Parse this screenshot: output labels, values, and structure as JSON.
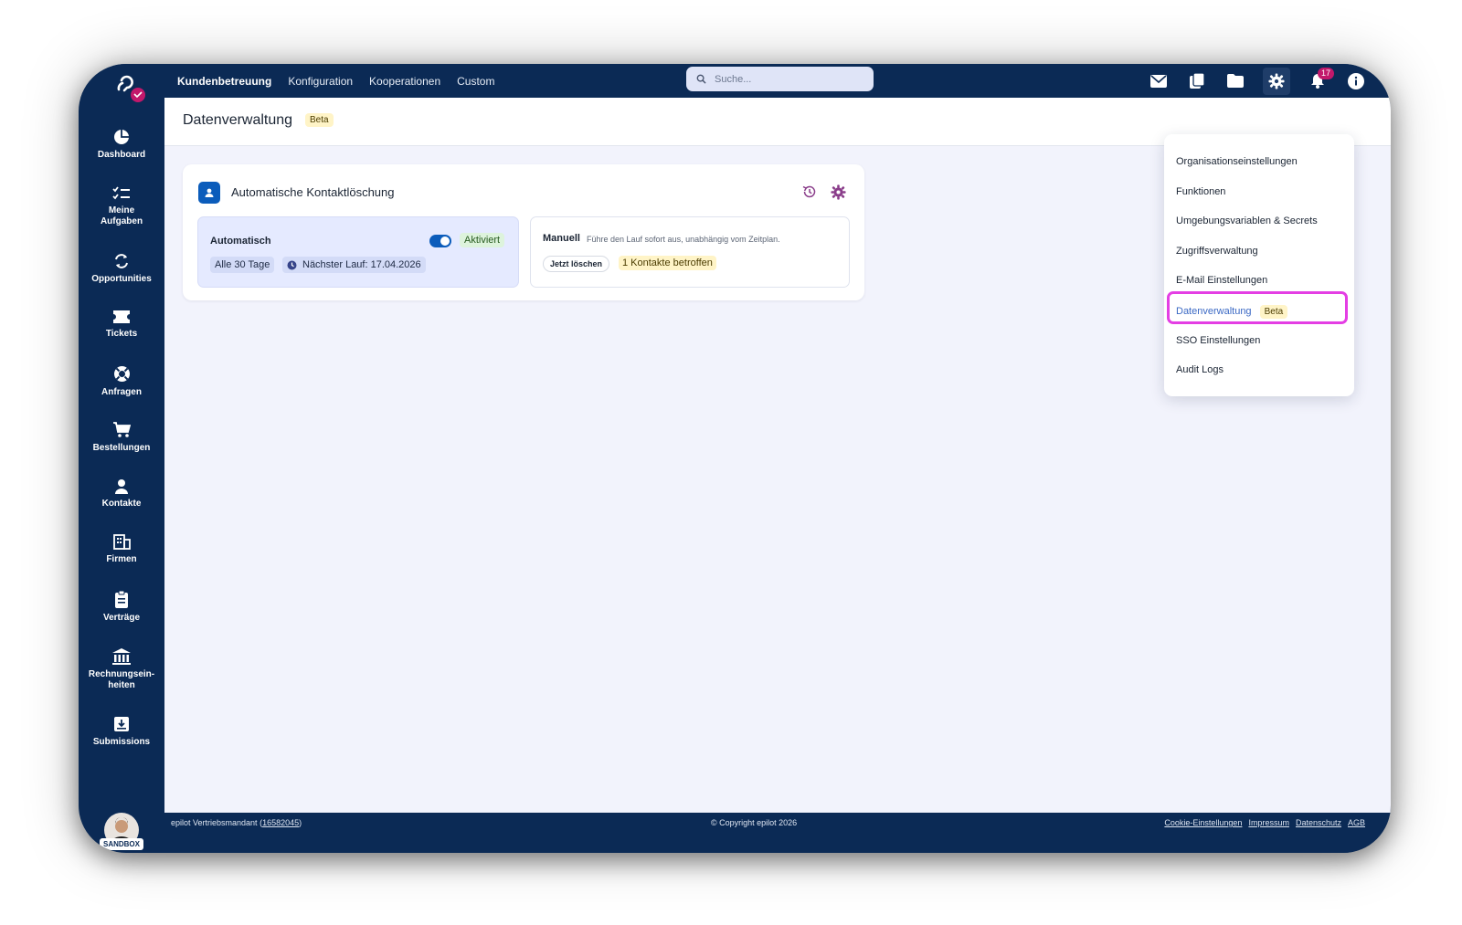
{
  "topbar": {
    "nav": [
      "Kundenbetreuung",
      "Konfiguration",
      "Kooperationen",
      "Custom"
    ],
    "search_placeholder": "Suche...",
    "notification_count": "17"
  },
  "sidebar": {
    "items": [
      {
        "label": "Dashboard"
      },
      {
        "label": "Meine Aufgaben"
      },
      {
        "label": "Opportunities"
      },
      {
        "label": "Tickets"
      },
      {
        "label": "Anfragen"
      },
      {
        "label": "Bestellungen"
      },
      {
        "label": "Kontakte"
      },
      {
        "label": "Firmen"
      },
      {
        "label": "Verträge"
      },
      {
        "label": "Rechnungsein-heiten"
      },
      {
        "label": "Submissions"
      }
    ],
    "env_badge": "SANDBOX"
  },
  "page": {
    "title": "Datenverwaltung",
    "badge": "Beta"
  },
  "card": {
    "title": "Automatische Kontaktlöschung",
    "auto": {
      "label": "Automatisch",
      "status": "Aktiviert",
      "enabled": true,
      "interval": "Alle 30 Tage",
      "next_run": "Nächster Lauf: 17.04.2026"
    },
    "manual": {
      "label": "Manuell",
      "description": "Führe den Lauf sofort aus, unabhängig vom Zeitplan.",
      "button": "Jetzt löschen",
      "affected": "1 Kontakte betroffen"
    }
  },
  "dropdown": {
    "items": [
      "Organisationseinstellungen",
      "Funktionen",
      "Umgebungsvariablen & Secrets",
      "Zugriffsverwaltung",
      "E-Mail Einstellungen",
      "Datenverwaltung",
      "SSO Einstellungen",
      "Audit Logs"
    ],
    "active_badge": "Beta"
  },
  "footer": {
    "tenant": "epilot Vertriebsmandant",
    "tenant_id": "16582045",
    "copyright": "© Copyright epilot 2026",
    "links": [
      "Cookie-Einstellungen",
      "Impressum",
      "Datenschutz",
      "AGB"
    ]
  },
  "colors": {
    "navy": "#0b2a55",
    "primary": "#0b5cbb",
    "highlight": "#e43ee4",
    "beta_bg": "#fff4c7",
    "active_bg": "#ddf3dc"
  }
}
